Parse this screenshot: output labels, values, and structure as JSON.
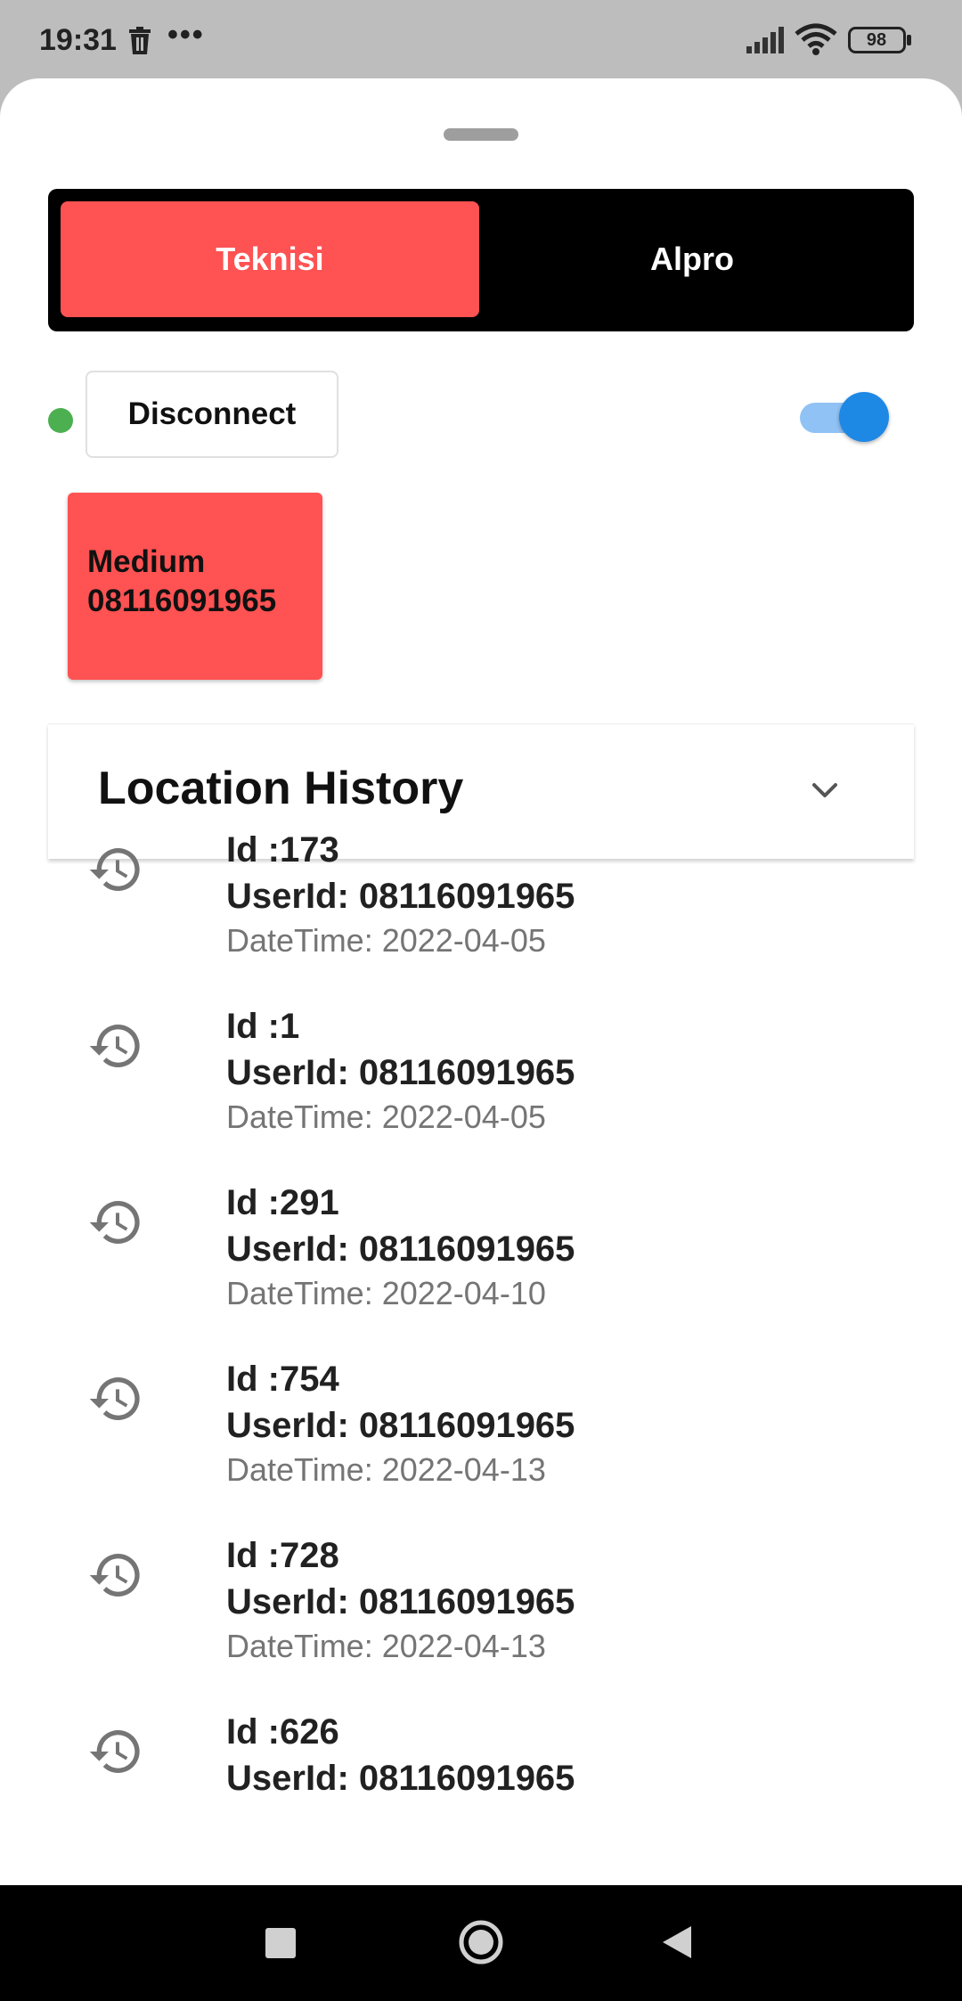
{
  "status_bar": {
    "time": "19:31",
    "dots": "•••",
    "battery": "98",
    "icons": [
      "trash-icon",
      "signal-icon",
      "wifi-icon",
      "battery-icon"
    ]
  },
  "tabs": [
    {
      "label": "Teknisi",
      "active": true
    },
    {
      "label": "Alpro",
      "active": false
    }
  ],
  "connection": {
    "status_color": "#4caf50",
    "button_label": "Disconnect",
    "toggle_on": true
  },
  "user_card": {
    "line1": "Medium",
    "line2": "08116091965"
  },
  "location_history": {
    "title": "Location History",
    "expand_icon": "chevron-down-icon",
    "item_icon": "history-icon",
    "items": [
      {
        "id": "Id :173",
        "user": "UserId: 08116091965",
        "date": "DateTime: 2022-04-05"
      },
      {
        "id": "Id :1",
        "user": "UserId: 08116091965",
        "date": "DateTime: 2022-04-05"
      },
      {
        "id": "Id :291",
        "user": "UserId: 08116091965",
        "date": "DateTime: 2022-04-10"
      },
      {
        "id": "Id :754",
        "user": "UserId: 08116091965",
        "date": "DateTime: 2022-04-13"
      },
      {
        "id": "Id :728",
        "user": "UserId: 08116091965",
        "date": "DateTime: 2022-04-13"
      },
      {
        "id": "Id :626",
        "user": "UserId: 08116091965",
        "date": ""
      }
    ]
  },
  "colors": {
    "accent_red": "#ff5252",
    "toggle_blue": "#1e88e5"
  },
  "nav_bar": {
    "icons": [
      "recents-square-icon",
      "home-circle-icon",
      "back-triangle-icon"
    ]
  }
}
